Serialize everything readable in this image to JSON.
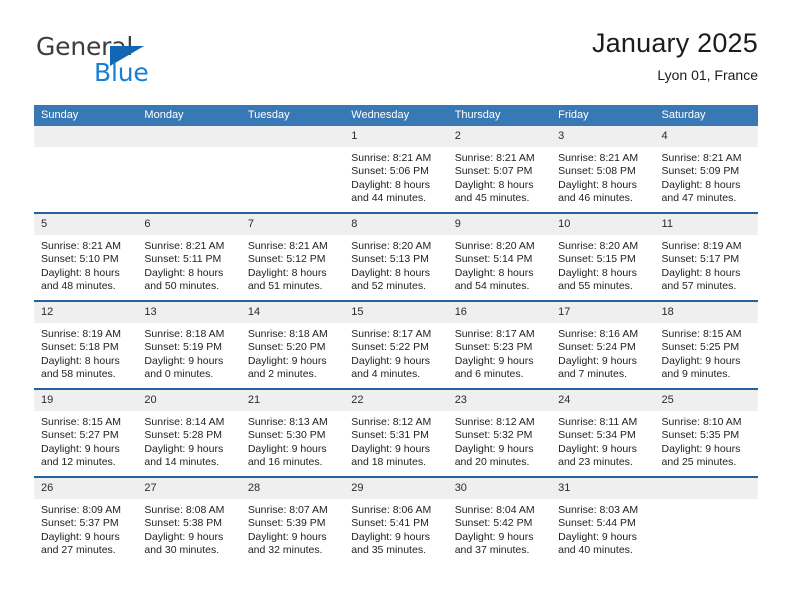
{
  "brand": {
    "name_part1": "General",
    "name_part2": "Blue",
    "triangle_color": "#1267b2",
    "blue_color": "#1a7fd4",
    "gray_color": "#3d3d3d"
  },
  "header": {
    "title": "January 2025",
    "location": "Lyon 01, France"
  },
  "theme": {
    "header_bg": "#3878b4",
    "row_divider": "#22639f",
    "daynum_bg": "#efefef"
  },
  "weekday_headers": [
    "Sunday",
    "Monday",
    "Tuesday",
    "Wednesday",
    "Thursday",
    "Friday",
    "Saturday"
  ],
  "weeks": [
    [
      {
        "day": "",
        "blank": true,
        "sunrise": "",
        "sunset": "",
        "daylight1": "",
        "daylight2": ""
      },
      {
        "day": "",
        "blank": true,
        "sunrise": "",
        "sunset": "",
        "daylight1": "",
        "daylight2": ""
      },
      {
        "day": "",
        "blank": true,
        "sunrise": "",
        "sunset": "",
        "daylight1": "",
        "daylight2": ""
      },
      {
        "day": "1",
        "blank": false,
        "sunrise": "Sunrise: 8:21 AM",
        "sunset": "Sunset: 5:06 PM",
        "daylight1": "Daylight: 8 hours",
        "daylight2": "and 44 minutes."
      },
      {
        "day": "2",
        "blank": false,
        "sunrise": "Sunrise: 8:21 AM",
        "sunset": "Sunset: 5:07 PM",
        "daylight1": "Daylight: 8 hours",
        "daylight2": "and 45 minutes."
      },
      {
        "day": "3",
        "blank": false,
        "sunrise": "Sunrise: 8:21 AM",
        "sunset": "Sunset: 5:08 PM",
        "daylight1": "Daylight: 8 hours",
        "daylight2": "and 46 minutes."
      },
      {
        "day": "4",
        "blank": false,
        "sunrise": "Sunrise: 8:21 AM",
        "sunset": "Sunset: 5:09 PM",
        "daylight1": "Daylight: 8 hours",
        "daylight2": "and 47 minutes."
      }
    ],
    [
      {
        "day": "5",
        "blank": false,
        "sunrise": "Sunrise: 8:21 AM",
        "sunset": "Sunset: 5:10 PM",
        "daylight1": "Daylight: 8 hours",
        "daylight2": "and 48 minutes."
      },
      {
        "day": "6",
        "blank": false,
        "sunrise": "Sunrise: 8:21 AM",
        "sunset": "Sunset: 5:11 PM",
        "daylight1": "Daylight: 8 hours",
        "daylight2": "and 50 minutes."
      },
      {
        "day": "7",
        "blank": false,
        "sunrise": "Sunrise: 8:21 AM",
        "sunset": "Sunset: 5:12 PM",
        "daylight1": "Daylight: 8 hours",
        "daylight2": "and 51 minutes."
      },
      {
        "day": "8",
        "blank": false,
        "sunrise": "Sunrise: 8:20 AM",
        "sunset": "Sunset: 5:13 PM",
        "daylight1": "Daylight: 8 hours",
        "daylight2": "and 52 minutes."
      },
      {
        "day": "9",
        "blank": false,
        "sunrise": "Sunrise: 8:20 AM",
        "sunset": "Sunset: 5:14 PM",
        "daylight1": "Daylight: 8 hours",
        "daylight2": "and 54 minutes."
      },
      {
        "day": "10",
        "blank": false,
        "sunrise": "Sunrise: 8:20 AM",
        "sunset": "Sunset: 5:15 PM",
        "daylight1": "Daylight: 8 hours",
        "daylight2": "and 55 minutes."
      },
      {
        "day": "11",
        "blank": false,
        "sunrise": "Sunrise: 8:19 AM",
        "sunset": "Sunset: 5:17 PM",
        "daylight1": "Daylight: 8 hours",
        "daylight2": "and 57 minutes."
      }
    ],
    [
      {
        "day": "12",
        "blank": false,
        "sunrise": "Sunrise: 8:19 AM",
        "sunset": "Sunset: 5:18 PM",
        "daylight1": "Daylight: 8 hours",
        "daylight2": "and 58 minutes."
      },
      {
        "day": "13",
        "blank": false,
        "sunrise": "Sunrise: 8:18 AM",
        "sunset": "Sunset: 5:19 PM",
        "daylight1": "Daylight: 9 hours",
        "daylight2": "and 0 minutes."
      },
      {
        "day": "14",
        "blank": false,
        "sunrise": "Sunrise: 8:18 AM",
        "sunset": "Sunset: 5:20 PM",
        "daylight1": "Daylight: 9 hours",
        "daylight2": "and 2 minutes."
      },
      {
        "day": "15",
        "blank": false,
        "sunrise": "Sunrise: 8:17 AM",
        "sunset": "Sunset: 5:22 PM",
        "daylight1": "Daylight: 9 hours",
        "daylight2": "and 4 minutes."
      },
      {
        "day": "16",
        "blank": false,
        "sunrise": "Sunrise: 8:17 AM",
        "sunset": "Sunset: 5:23 PM",
        "daylight1": "Daylight: 9 hours",
        "daylight2": "and 6 minutes."
      },
      {
        "day": "17",
        "blank": false,
        "sunrise": "Sunrise: 8:16 AM",
        "sunset": "Sunset: 5:24 PM",
        "daylight1": "Daylight: 9 hours",
        "daylight2": "and 7 minutes."
      },
      {
        "day": "18",
        "blank": false,
        "sunrise": "Sunrise: 8:15 AM",
        "sunset": "Sunset: 5:25 PM",
        "daylight1": "Daylight: 9 hours",
        "daylight2": "and 9 minutes."
      }
    ],
    [
      {
        "day": "19",
        "blank": false,
        "sunrise": "Sunrise: 8:15 AM",
        "sunset": "Sunset: 5:27 PM",
        "daylight1": "Daylight: 9 hours",
        "daylight2": "and 12 minutes."
      },
      {
        "day": "20",
        "blank": false,
        "sunrise": "Sunrise: 8:14 AM",
        "sunset": "Sunset: 5:28 PM",
        "daylight1": "Daylight: 9 hours",
        "daylight2": "and 14 minutes."
      },
      {
        "day": "21",
        "blank": false,
        "sunrise": "Sunrise: 8:13 AM",
        "sunset": "Sunset: 5:30 PM",
        "daylight1": "Daylight: 9 hours",
        "daylight2": "and 16 minutes."
      },
      {
        "day": "22",
        "blank": false,
        "sunrise": "Sunrise: 8:12 AM",
        "sunset": "Sunset: 5:31 PM",
        "daylight1": "Daylight: 9 hours",
        "daylight2": "and 18 minutes."
      },
      {
        "day": "23",
        "blank": false,
        "sunrise": "Sunrise: 8:12 AM",
        "sunset": "Sunset: 5:32 PM",
        "daylight1": "Daylight: 9 hours",
        "daylight2": "and 20 minutes."
      },
      {
        "day": "24",
        "blank": false,
        "sunrise": "Sunrise: 8:11 AM",
        "sunset": "Sunset: 5:34 PM",
        "daylight1": "Daylight: 9 hours",
        "daylight2": "and 23 minutes."
      },
      {
        "day": "25",
        "blank": false,
        "sunrise": "Sunrise: 8:10 AM",
        "sunset": "Sunset: 5:35 PM",
        "daylight1": "Daylight: 9 hours",
        "daylight2": "and 25 minutes."
      }
    ],
    [
      {
        "day": "26",
        "blank": false,
        "sunrise": "Sunrise: 8:09 AM",
        "sunset": "Sunset: 5:37 PM",
        "daylight1": "Daylight: 9 hours",
        "daylight2": "and 27 minutes."
      },
      {
        "day": "27",
        "blank": false,
        "sunrise": "Sunrise: 8:08 AM",
        "sunset": "Sunset: 5:38 PM",
        "daylight1": "Daylight: 9 hours",
        "daylight2": "and 30 minutes."
      },
      {
        "day": "28",
        "blank": false,
        "sunrise": "Sunrise: 8:07 AM",
        "sunset": "Sunset: 5:39 PM",
        "daylight1": "Daylight: 9 hours",
        "daylight2": "and 32 minutes."
      },
      {
        "day": "29",
        "blank": false,
        "sunrise": "Sunrise: 8:06 AM",
        "sunset": "Sunset: 5:41 PM",
        "daylight1": "Daylight: 9 hours",
        "daylight2": "and 35 minutes."
      },
      {
        "day": "30",
        "blank": false,
        "sunrise": "Sunrise: 8:04 AM",
        "sunset": "Sunset: 5:42 PM",
        "daylight1": "Daylight: 9 hours",
        "daylight2": "and 37 minutes."
      },
      {
        "day": "31",
        "blank": false,
        "sunrise": "Sunrise: 8:03 AM",
        "sunset": "Sunset: 5:44 PM",
        "daylight1": "Daylight: 9 hours",
        "daylight2": "and 40 minutes."
      },
      {
        "day": "",
        "blank": true,
        "sunrise": "",
        "sunset": "",
        "daylight1": "",
        "daylight2": ""
      }
    ]
  ]
}
